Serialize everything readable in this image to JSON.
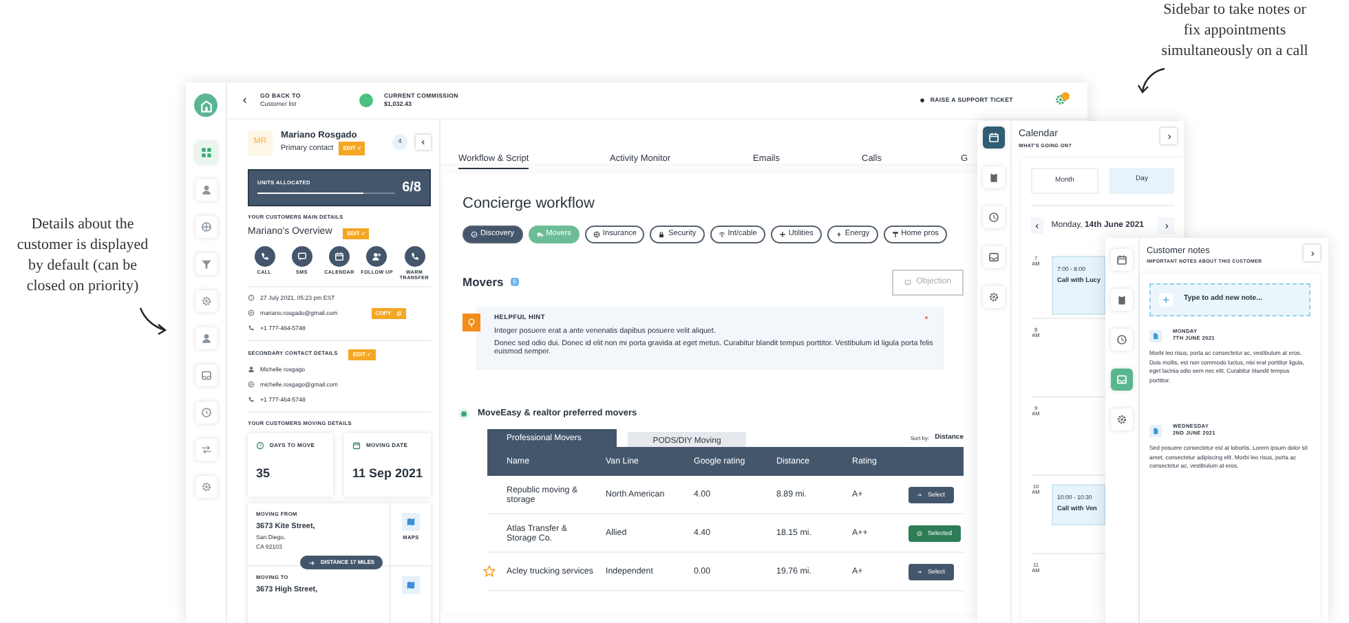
{
  "annotations": [
    {
      "text": "Details about the customer is displayed by default (can be closed on priority)"
    },
    {
      "text": "Sidebar to take notes or fix appointments simultaneously on a call"
    }
  ],
  "app": {
    "nav_rail": [
      {
        "selected": true
      },
      {
        "selected": false
      },
      {
        "selected": false
      },
      {
        "selected": false
      },
      {
        "selected": false
      },
      {
        "selected": false
      },
      {
        "selected": false
      },
      {
        "selected": false
      },
      {
        "selected": false
      },
      {
        "selected": false
      }
    ],
    "top_bar": {
      "back_label": "GO BACK TO",
      "back_target": "Customer list",
      "commission_label": "CURRENT COMMISSION",
      "commission": "$1,032.43",
      "support": "RAISE A SUPPORT TICKET"
    },
    "customer": {
      "initials": "MR",
      "name": "Mariano Rosgado",
      "role": "Primary contact",
      "edit": "EDIT ✓",
      "count": "4",
      "units": {
        "label": "UNITS ALLOCATED",
        "value": "6/8",
        "level": 0.77
      },
      "main_heading": "YOUR CUSTOMERS MAIN DETAILS",
      "overview": "Mariano's Overview",
      "overview_edit": "EDIT ✓",
      "actions": [
        {
          "label": "CALL"
        },
        {
          "label": "SMS"
        },
        {
          "label": "CALENDAR"
        },
        {
          "label": "FOLLOW UP"
        },
        {
          "label": "WARM TRANSFER"
        }
      ],
      "date": "27 July 2021, 05:23 pm EST",
      "email": "mariano.rosgado@gmail.com",
      "copy": "COPY",
      "phone": "+1 777-464-5748",
      "secondary_heading": "SECONDARY CONTACT DETAILS",
      "secondary_edit": "EDIT ✓",
      "secondary_name": "Michelle rosgago",
      "secondary_email": "michelle.rosgago@gmail.com",
      "secondary_phone": "+1 777-464-5748",
      "moving_heading": "YOUR CUSTOMERS MOVING DETAILS",
      "stats": [
        {
          "label": "DAYS TO MOVE",
          "value": "35"
        },
        {
          "label": "MOVING DATE",
          "value": "11 Sep 2021"
        }
      ],
      "from": {
        "label": "MOVING FROM",
        "street": "3673 Kite Street,",
        "city": "San Diego,",
        "zip": "CA 92103",
        "maps": "MAPS"
      },
      "distance": "DISTANCE 17 MILES",
      "to": {
        "label": "MOVING TO",
        "street": "3673 High Street,"
      }
    },
    "tabs": [
      {
        "label": "Workflow & Script",
        "selected": true
      },
      {
        "label": "Activity Monitor",
        "selected": false
      },
      {
        "label": "Emails",
        "selected": false
      },
      {
        "label": "Calls",
        "selected": false
      },
      {
        "label": "G",
        "selected": false
      }
    ],
    "workflow": {
      "title": "Concierge workflow",
      "steps": [
        {
          "label": "Discovery",
          "completed": true,
          "selected": false
        },
        {
          "label": "Movers",
          "completed": false,
          "selected": true
        },
        {
          "label": "Insurance",
          "completed": false,
          "selected": false
        },
        {
          "label": "Security",
          "completed": false,
          "selected": false
        },
        {
          "label": "Int/cable",
          "completed": false,
          "selected": false
        },
        {
          "label": "Utilities",
          "completed": false,
          "selected": false
        },
        {
          "label": "Energy",
          "completed": false,
          "selected": false
        },
        {
          "label": "Home pros",
          "completed": false,
          "selected": false
        }
      ],
      "section": "Movers",
      "section_count": "5",
      "objection": "Objection",
      "hint": {
        "title": "HELPFUL HINT",
        "lines": [
          "Integer posuere erat a ante venenatis dapibus posuere velit aliquet.",
          "Donec sed odio dui. Donec id elit non mi porta gravida at eget metus. Curabitur blandit tempus porttitor. Vestibulum id ligula porta felis euismod semper."
        ]
      },
      "group_title": "MoveEasy & realtor preferred movers",
      "subtabs": [
        {
          "label": "Professional Movers",
          "selected": true
        },
        {
          "label": "PODS/DIY Moving",
          "selected": false
        }
      ],
      "sort_label": "Sort by:",
      "sort_value": "Distance",
      "table": {
        "columns": [
          "Name",
          "Van Line",
          "Google rating",
          "Distance",
          "Rating"
        ],
        "rows": [
          {
            "name": "Republic moving & storage",
            "van_line": "North American",
            "google_rating": "4.00",
            "distance": "8.89 mi.",
            "rating": "A+",
            "favorite": false,
            "selected": false,
            "action": "Select"
          },
          {
            "name": "Atlas Transfer & Storage Co.",
            "van_line": "Allied",
            "google_rating": "4.40",
            "distance": "18.15 mi.",
            "rating": "A++",
            "favorite": false,
            "selected": true,
            "action": "Selected"
          },
          {
            "name": "Acley trucking services",
            "van_line": "Independent",
            "google_rating": "0.00",
            "distance": "19.76 mi.",
            "rating": "A+",
            "favorite": true,
            "selected": false,
            "action": "Select"
          }
        ]
      }
    }
  },
  "calendar": {
    "title": "Calendar",
    "subtitle": "WHAT'S GOING ON?",
    "rail": [
      {
        "selected": true
      },
      {
        "selected": false
      },
      {
        "selected": false
      },
      {
        "selected": false
      },
      {
        "selected": false
      }
    ],
    "views": [
      {
        "label": "Month",
        "selected": false
      },
      {
        "label": "Day",
        "selected": true
      }
    ],
    "date": "Monday, **14th June 2021**",
    "hours": [
      {
        "label": "7 AM",
        "event": {
          "time": "7:00 - 8:00",
          "title": "Call with Lucy"
        }
      },
      {
        "label": "8 AM"
      },
      {
        "label": "9 AM"
      },
      {
        "label": "10 AM",
        "event": {
          "time": "10:00 - 10:30",
          "title": "Call with Ven"
        }
      },
      {
        "label": "11 AM"
      }
    ]
  },
  "notes": {
    "title": "Customer notes",
    "subtitle": "IMPORTANT NOTES ABOUT THIS CUSTOMER",
    "rail": [
      {
        "selected": false
      },
      {
        "selected": false
      },
      {
        "selected": false
      },
      {
        "selected": true
      },
      {
        "selected": false
      }
    ],
    "placeholder": "Type to add new note...",
    "items": [
      {
        "day": "MONDAY",
        "date": "7TH JUNE 2021",
        "text": "Morbi leo risus, porta ac consectetur ac, vestibulum at eros. Duis mollis, est non commodo luctus, nisi erat porttitor ligula, eget lacinia odio sem nec elit. Curabitur blandit tempus porttitor."
      },
      {
        "day": "WEDNESDAY",
        "date": "2ND JUNE 2021",
        "text": "Sed posuere consectetur est at lobortis. Lorem ipsum dolor sit amet, consectetur adipiscing elit. Morbi leo risus, porta ac consectetur ac, vestibulum at eros."
      }
    ]
  }
}
